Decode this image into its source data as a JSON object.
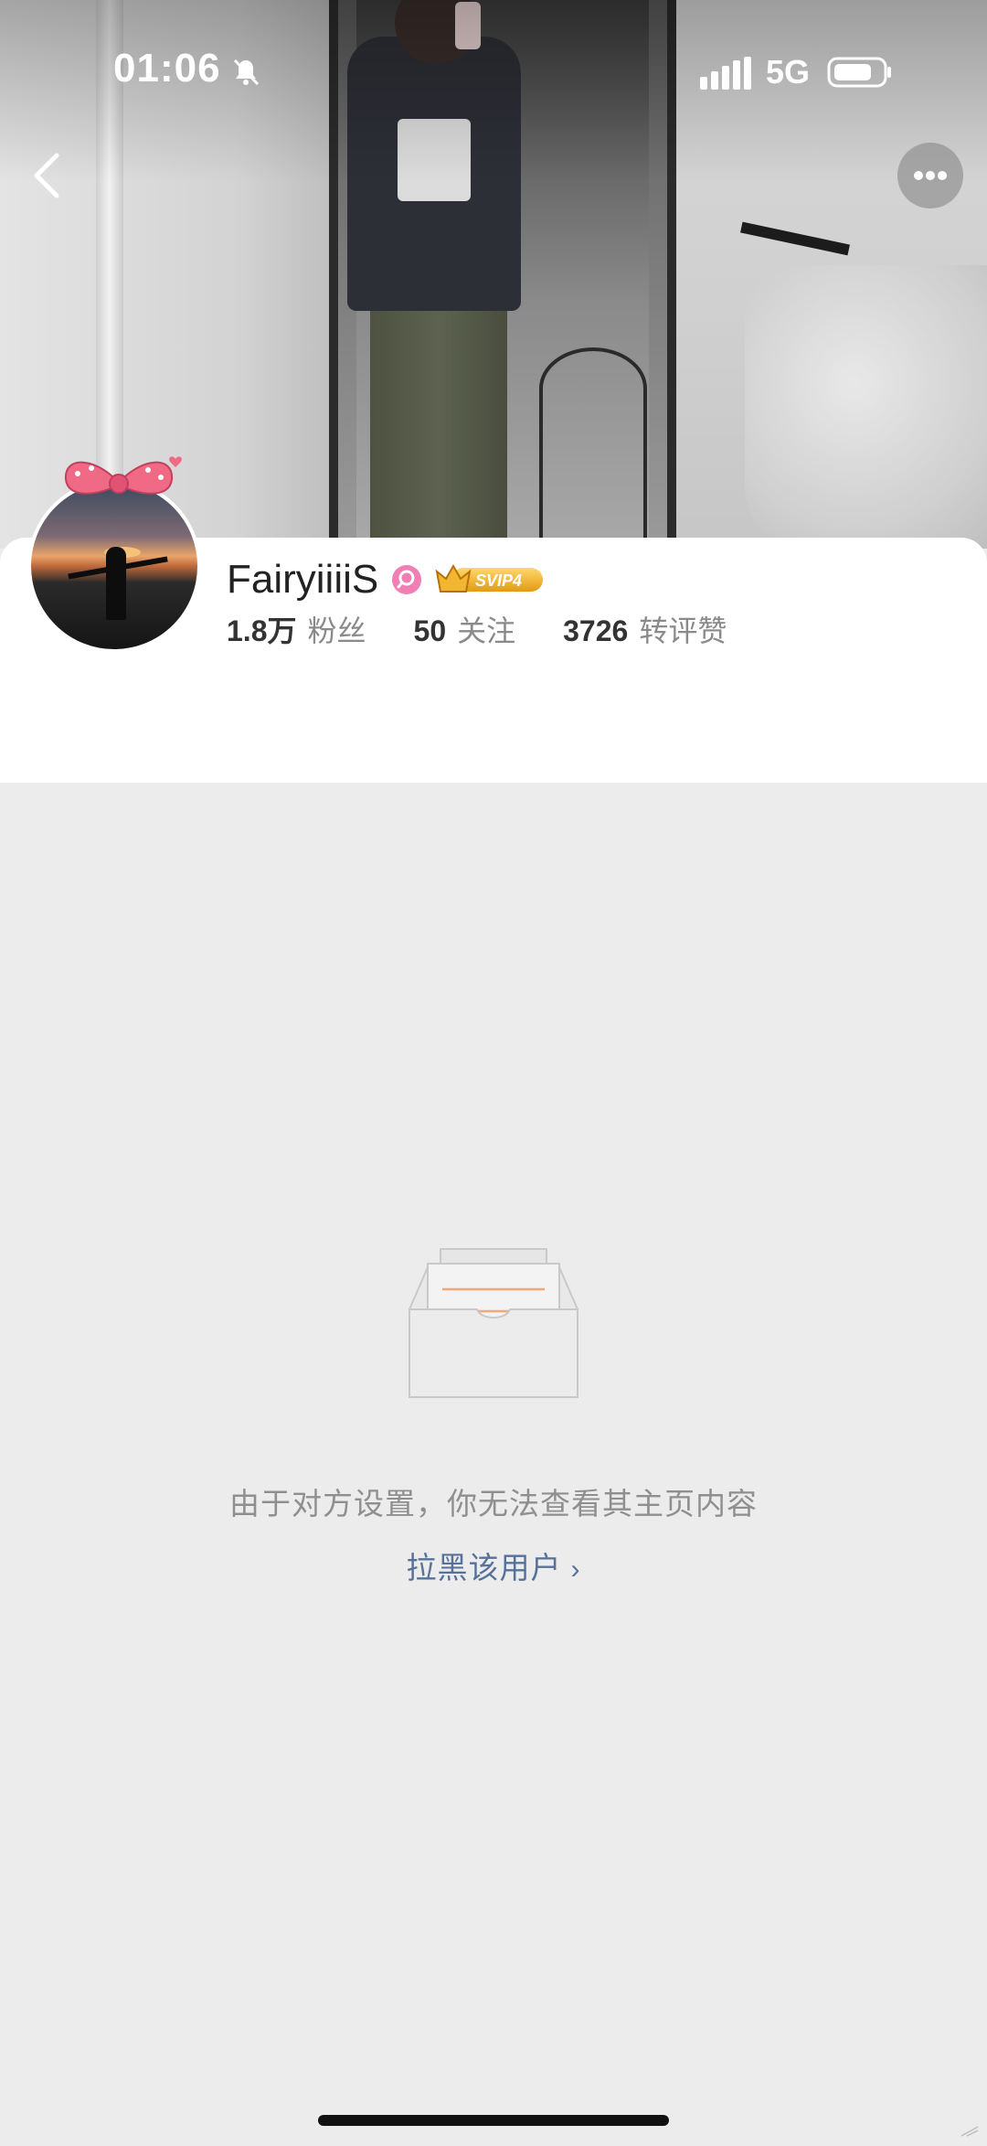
{
  "status_bar": {
    "time": "01:06",
    "network": "5G"
  },
  "profile": {
    "username": "FairyiiiiS",
    "badge_label": "SVIP4",
    "stats": [
      {
        "value": "1.8万",
        "label": "粉丝"
      },
      {
        "value": "50",
        "label": "关注"
      },
      {
        "value": "3726",
        "label": "转评赞"
      }
    ]
  },
  "empty_state": {
    "message": "由于对方设置，你无法查看其主页内容",
    "block_link": "拉黑该用户",
    "block_chevron": "›"
  },
  "icons": {
    "back": "chevron-left-icon",
    "more": "more-dots-icon",
    "verify": "verified-icon",
    "bell": "bell-off-icon"
  },
  "colors": {
    "link": "#57729a",
    "verify": "#f07fb3",
    "svip_gold": "#e9a020"
  }
}
